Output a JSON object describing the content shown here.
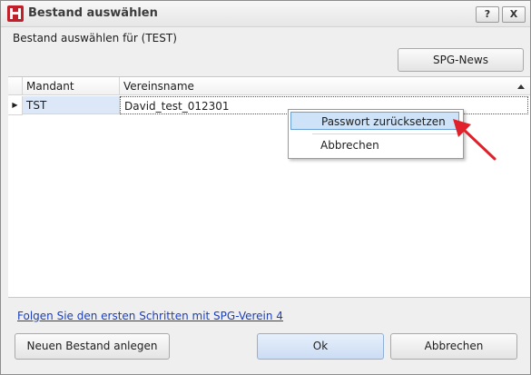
{
  "window": {
    "title": "Bestand auswählen",
    "help_button": "?",
    "close_button": "X"
  },
  "subtitle": "Bestand auswählen für  (TEST)",
  "toolbar": {
    "news_button": "SPG-News"
  },
  "grid": {
    "columns": [
      "Mandant",
      "Vereinsname"
    ],
    "rows": [
      {
        "mandant": "TST",
        "vereinsname": "David_test_012301"
      }
    ]
  },
  "context_menu": {
    "items": [
      "Passwort zurücksetzen",
      "Abbrechen"
    ]
  },
  "footer": {
    "link": "Folgen Sie den ersten Schritten mit SPG-Verein 4",
    "new_button": "Neuen Bestand anlegen",
    "ok_button": "Ok",
    "cancel_button": "Abbrechen"
  },
  "colors": {
    "app_icon": "#c0202a",
    "selection": "#cfe3f8",
    "arrow": "#e0202a",
    "link": "#1a3fbf"
  }
}
